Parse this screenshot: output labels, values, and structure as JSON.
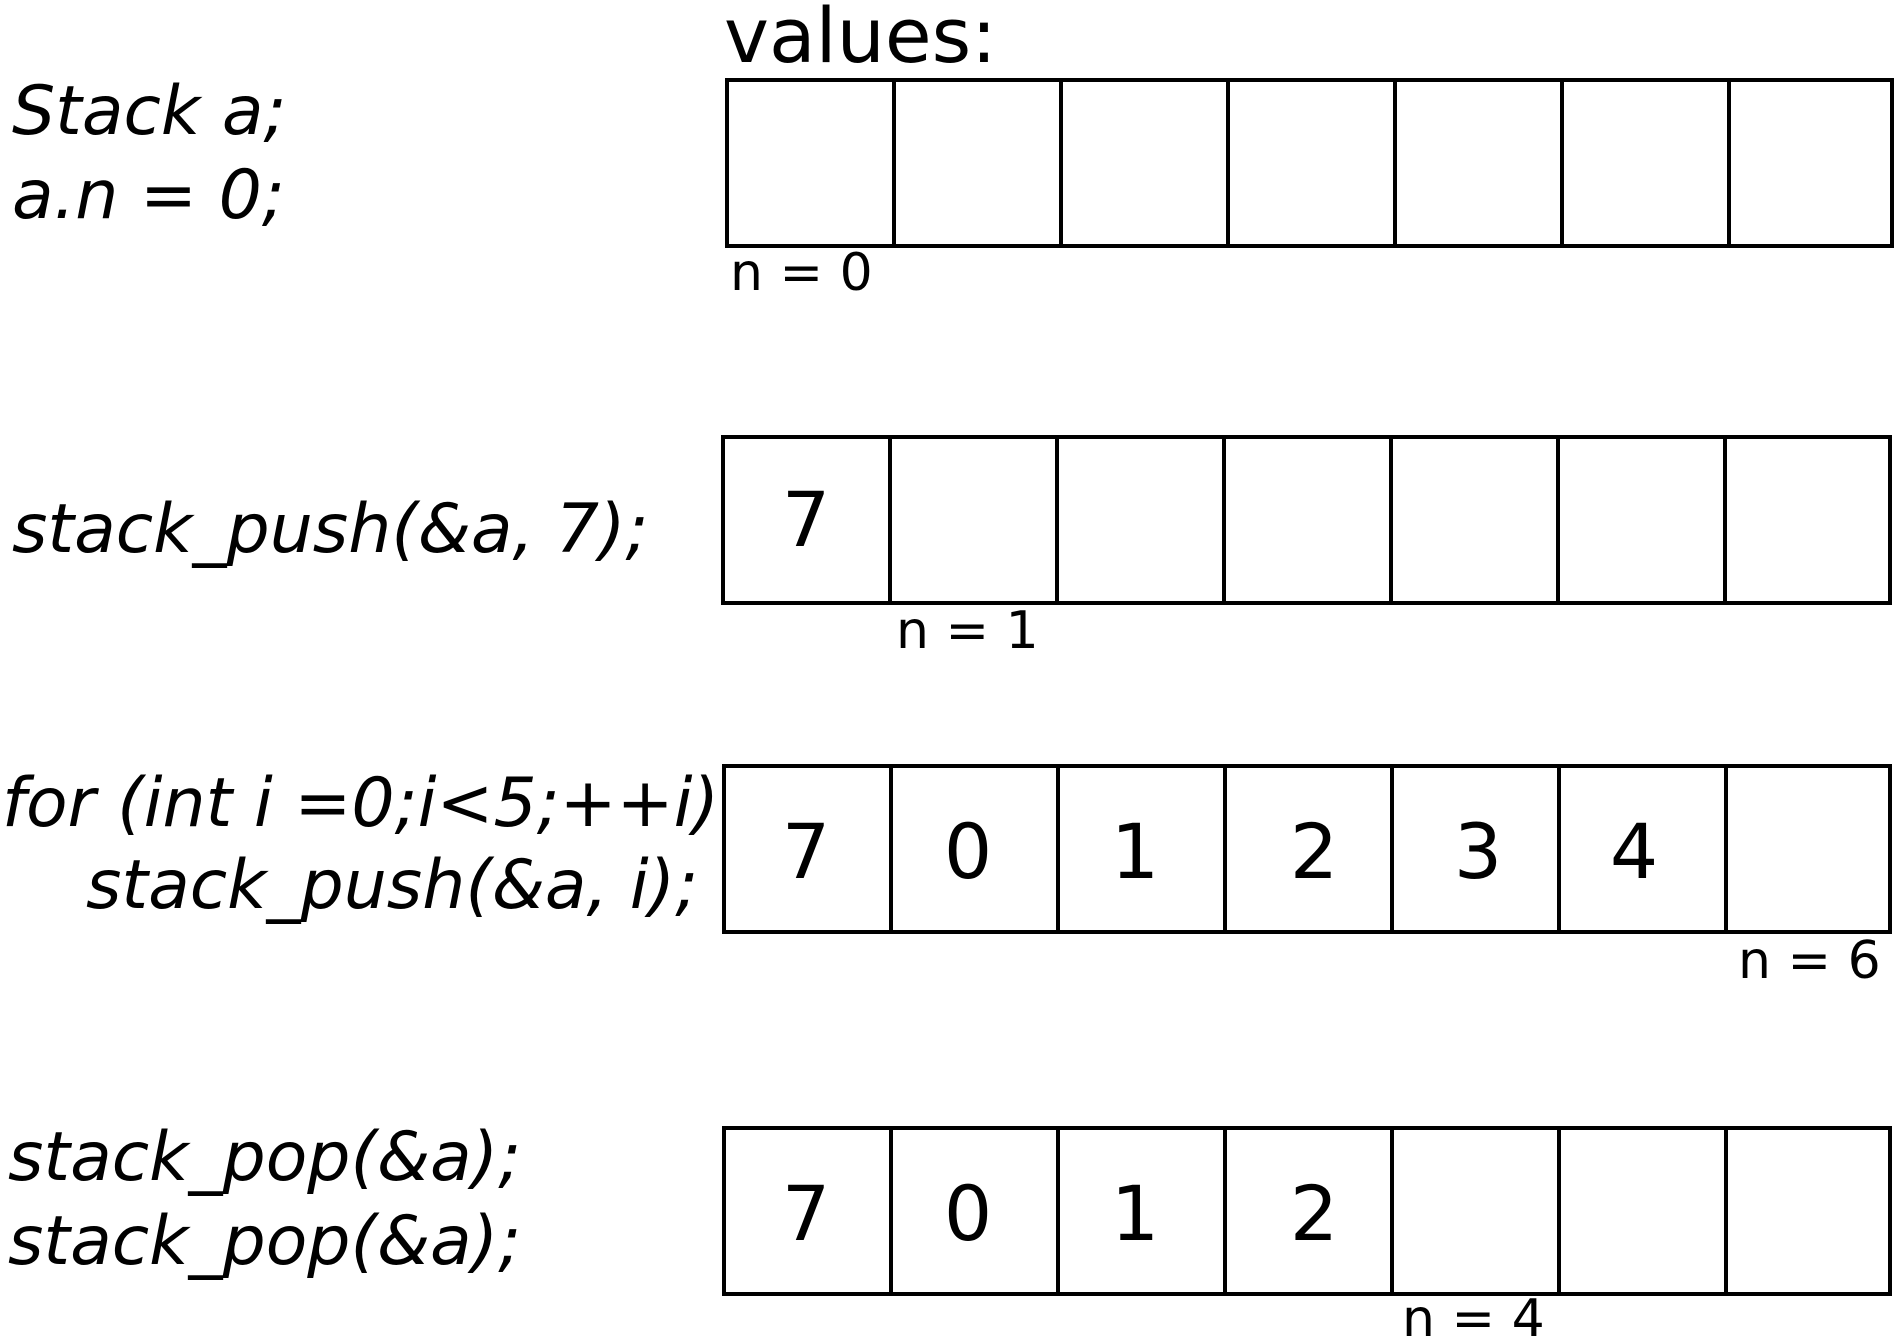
{
  "title": "values:",
  "rows": [
    {
      "code": [
        "Stack a;",
        "a.n = 0;"
      ],
      "cells": [
        "",
        "",
        "",
        "",
        "",
        "",
        ""
      ],
      "n_label": "n = 0"
    },
    {
      "code": [
        "stack_push(&a, 7);"
      ],
      "cells": [
        "7",
        "",
        "",
        "",
        "",
        "",
        ""
      ],
      "n_label": "n = 1"
    },
    {
      "code": [
        "for (int i =0;i<5;++i)",
        "stack_push(&a, i);"
      ],
      "cells": [
        "7",
        "0",
        "1",
        "2",
        "3",
        "4",
        ""
      ],
      "n_label": "n = 6"
    },
    {
      "code": [
        "stack_pop(&a);",
        "stack_pop(&a);"
      ],
      "cells": [
        "7",
        "0",
        "1",
        "2",
        "",
        "",
        ""
      ],
      "n_label": "n = 4"
    }
  ]
}
